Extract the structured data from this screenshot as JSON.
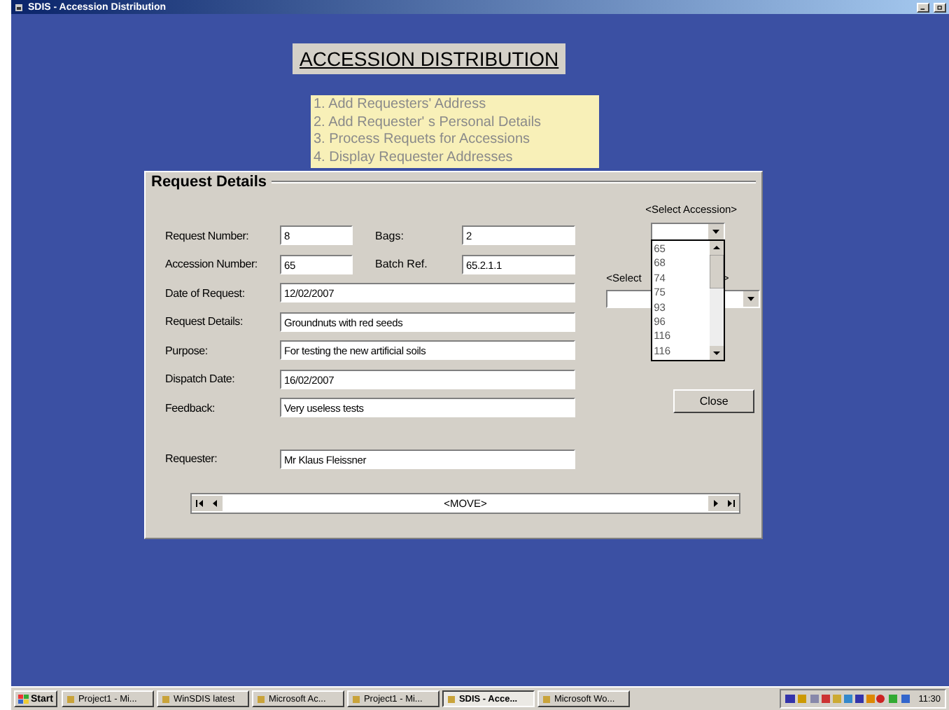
{
  "window": {
    "title": "SDIS - Accession Distribution"
  },
  "heading": "ACCESSION DISTRIBUTION",
  "menu": [
    "1. Add Requesters' Address",
    "2. Add Requester' s Personal Details",
    "3. Process Requets for Accessions",
    "4. Display Requester Addresses"
  ],
  "panel": {
    "title": "Request Details",
    "rows": [
      [
        {
          "label": "Request Number:",
          "value": "8"
        },
        {
          "label": "Bags:",
          "value": "2"
        }
      ],
      [
        {
          "label": "Accession Number:",
          "value": "65"
        },
        {
          "label": "Batch Ref.",
          "value": "65.2.1.1"
        }
      ],
      [
        {
          "label": "Date of Request:",
          "value": "12/02/2007"
        }
      ],
      [
        {
          "label": "Request Details:",
          "value": "Groundnuts with red seeds"
        }
      ],
      [
        {
          "label": "Purpose:",
          "value": "For testing the new artificial soils"
        }
      ],
      [
        {
          "label": "Dispatch Date:",
          "value": "16/02/2007"
        }
      ],
      [
        {
          "label": "Feedback:",
          "value": "Very useless tests"
        }
      ],
      [
        {
          "label": "Requester:",
          "value": "Mr Klaus Fleissner"
        }
      ]
    ],
    "select_accession": {
      "label": "<Select Accession>",
      "expanded": true,
      "options": [
        "65",
        "68",
        "74",
        "75",
        "93",
        "96",
        "116",
        "116"
      ]
    },
    "second_select": {
      "label_parts": [
        "<Select",
        ">"
      ]
    },
    "close_button": "Close",
    "navigator": {
      "label": "<MOVE>"
    }
  },
  "taskbar": {
    "start": "Start",
    "items": [
      {
        "label": "Project1 - Mi...",
        "selected": false
      },
      {
        "label": "WinSDIS latest",
        "selected": false
      },
      {
        "label": "Microsoft Ac...",
        "selected": false
      },
      {
        "label": "Project1 - Mi...",
        "selected": false
      },
      {
        "label": "SDIS - Acce...",
        "selected": true
      },
      {
        "label": "Microsoft Wo...",
        "selected": false
      }
    ],
    "clock": "11:30"
  }
}
